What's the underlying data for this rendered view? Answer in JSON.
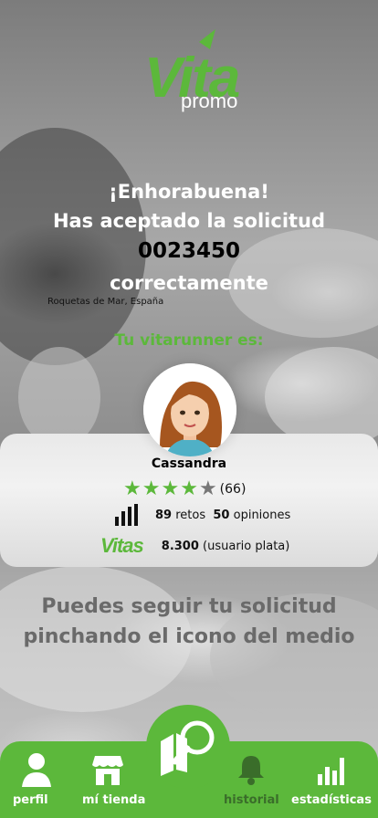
{
  "brand": {
    "logo_main": "Vita",
    "logo_sub": "promo"
  },
  "message": {
    "congrats": "¡Enhorabuena!",
    "accepted": "Has aceptado la solicitud",
    "request_id": "0023450",
    "correctly": "correctamente",
    "location": "Roquetas de Mar, España"
  },
  "vitarunner": {
    "title": "Tu vitarunner es:",
    "name": "Cassandra",
    "rating_stars": 4,
    "rating_max": 5,
    "rating_count": "(66)",
    "retos_value": "89",
    "retos_label": "retos",
    "opiniones_value": "50",
    "opiniones_label": "opiniones",
    "vitas_logo": "Vitas",
    "vitas_value": "8.300",
    "vitas_level": "(usuario plata)"
  },
  "follow_text": "Puedes seguir tu solicitud pinchando el icono del medio",
  "nav": {
    "perfil": "perfil",
    "mi_tienda": "mí tienda",
    "historial": "historial",
    "estadisticas": "estadísticas"
  },
  "colors": {
    "accent": "#5cb83b",
    "star_active": "#5cb83b",
    "star_inactive": "#777777"
  },
  "icons": [
    "person-icon",
    "store-icon",
    "map-search-icon",
    "bell-icon",
    "bar-chart-icon",
    "star-icon",
    "stats-icon"
  ]
}
